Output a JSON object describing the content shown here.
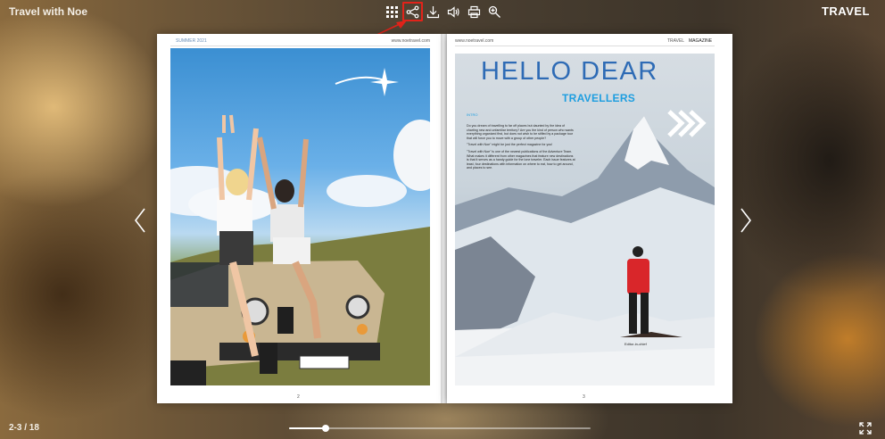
{
  "app": {
    "title": "Travel with Noe",
    "brand": "TRAVEL"
  },
  "toolbar": {
    "items": [
      {
        "name": "thumbnails-icon"
      },
      {
        "name": "share-icon",
        "active": true
      },
      {
        "name": "download-icon"
      },
      {
        "name": "sound-icon"
      },
      {
        "name": "print-icon"
      },
      {
        "name": "zoom-icon"
      }
    ],
    "highlight_color": "#e2231a"
  },
  "pages": {
    "left": {
      "header_left": "SUMMER 2021",
      "header_right": "www.noetravel.com",
      "number": "2"
    },
    "right": {
      "header_left": "www.noetravel.com",
      "header_travel": "TRAVEL",
      "header_magazine": "MAGAZINE",
      "number": "3",
      "headline": "HELLO DEAR",
      "subheadline": "TRAVELLERS",
      "intro": "INTRO",
      "para1": "Do you dream of travelling to far off places but daunted by the idea of charting new and unfamiliar territory? Are you the kind of person who wants everything organized first, but does not wish to be stifled by a package tour that will force you to move with a group of other people?",
      "para2": "\"Travel with Noe\" might be just the perfect magazine for you!",
      "para3": "\"Travel with Noe\" is one of the newest publications of the Adventure Team. What makes it different from other magazines that feature new destinations is that it serves as a handy guide for the lone traveler. Each issue features at least, four destinations with information on where to eat, how to get around, and places to see.",
      "signature": "Editor-in-chief"
    }
  },
  "navigation": {
    "counter": "2-3 / 18",
    "progress": 0.12
  },
  "colors": {
    "accent_blue": "#2e6bb5",
    "accent_cyan": "#1e9ee0"
  }
}
